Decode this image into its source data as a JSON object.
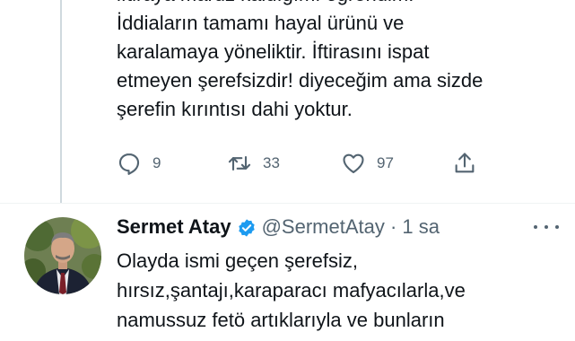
{
  "previous_tweet": {
    "lines": [
      "iftiraya maruz kaldığımı öğrendim.",
      "İddiaların tamamı hayal ürünü ve",
      "karalamaya yöneliktir. İftirasını ispat",
      "etmeyen şerefsizdir! diyeceğim ama sizde",
      "şerefin kırıntısı dahi yoktur."
    ],
    "actions": {
      "reply_icon": "reply-icon",
      "reply_count": "9",
      "retweet_icon": "retweet-icon",
      "retweet_count": "33",
      "like_icon": "heart-icon",
      "like_count": "97",
      "share_icon": "share-icon"
    }
  },
  "tweet": {
    "author_name": "Sermet Atay",
    "verified_icon": "verified-badge-icon",
    "handle_time": "@SermetAtay · 1 sa",
    "lines": [
      "Olayda ismi geçen şerefsiz,",
      "hırsız,şantajı,karaparacı mafyacılarla,ve",
      "namussuz fetö artıklarıyla ve bunların"
    ]
  },
  "colors": {
    "text": "#0f1419",
    "secondary": "#536471",
    "verified": "#1d9bf0",
    "thread_line": "#cfd9de"
  }
}
